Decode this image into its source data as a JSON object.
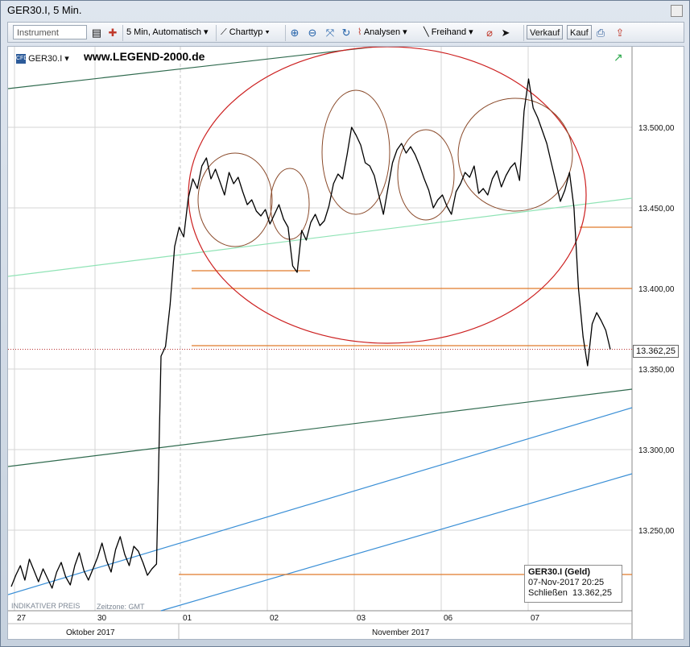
{
  "window": {
    "title": "GER30.I, 5 Min."
  },
  "toolbar": {
    "instrument_placeholder": "Instrument",
    "interval": "5 Min,",
    "mode": "Automatisch",
    "charttyp": "Charttyp",
    "analysen": "Analysen",
    "freihand": "Freihand",
    "verkauf": "Verkauf",
    "kauf": "Kauf"
  },
  "chart_header": {
    "symbol": "GER30.I",
    "watermark": "www.LEGEND-2000.de"
  },
  "footnote": "INDIKATIVER PREIS",
  "zeitzone": "Zeitzone: GMT",
  "last_price_label": "13.362,25",
  "infobox": {
    "title": "GER30.I (Geld)",
    "datetime": "07-Nov-2017 20:25",
    "close_label": "Schließen",
    "close_value": "13.362,25"
  },
  "colors": {
    "price": "#000000",
    "orange": "#e07a2a",
    "darkgreen": "#2f6a4e",
    "lightgreen": "#8fe3b5",
    "blue": "#3a8fd6",
    "red_circle": "#cc1f1f",
    "brown_circle": "#8a4a2a",
    "grid": "#d6d6d6"
  },
  "chart_data": {
    "type": "line",
    "title": "GER30.I, 5 Min.",
    "ylim": [
      13200,
      13550
    ],
    "y_ticks": [
      "13.250,00",
      "13.300,00",
      "13.350,00",
      "13.400,00",
      "13.450,00",
      "13.500,00"
    ],
    "x_ticks": [
      "27",
      "30",
      "01",
      "02",
      "03",
      "06",
      "07"
    ],
    "x_months": [
      "Oktober 2017",
      "November 2017"
    ],
    "last_value": 13362.25,
    "series": [
      {
        "values": [
          13215,
          13222,
          13228,
          13219,
          13232,
          13225,
          13218,
          13226,
          13220,
          13214,
          13224,
          13230,
          13221,
          13216,
          13228,
          13236,
          13225,
          13219,
          13226,
          13233,
          13242,
          13231,
          13224,
          13238,
          13246,
          13235,
          13228,
          13240,
          13237,
          13230,
          13222,
          13226,
          13229,
          13358,
          13364,
          13390,
          13426,
          13438,
          13432,
          13456,
          13468,
          13462,
          13476,
          13481,
          13468,
          13474,
          13466,
          13458,
          13472,
          13465,
          13469,
          13460,
          13452,
          13455,
          13448,
          13445,
          13449,
          13440,
          13446,
          13452,
          13443,
          13438,
          13414,
          13410,
          13436,
          13430,
          13441,
          13446,
          13439,
          13442,
          13451,
          13465,
          13471,
          13468,
          13483,
          13500,
          13495,
          13489,
          13478,
          13476,
          13470,
          13458,
          13446,
          13462,
          13478,
          13486,
          13490,
          13484,
          13488,
          13483,
          13476,
          13468,
          13461,
          13450,
          13455,
          13458,
          13451,
          13446,
          13460,
          13465,
          13472,
          13469,
          13476,
          13459,
          13462,
          13458,
          13468,
          13473,
          13463,
          13470,
          13475,
          13478,
          13467,
          13510,
          13530,
          13512,
          13506,
          13498,
          13490,
          13478,
          13466,
          13454,
          13461,
          13472,
          13450,
          13400,
          13370,
          13352,
          13378,
          13385,
          13380,
          13374,
          13362.25
        ]
      }
    ]
  }
}
